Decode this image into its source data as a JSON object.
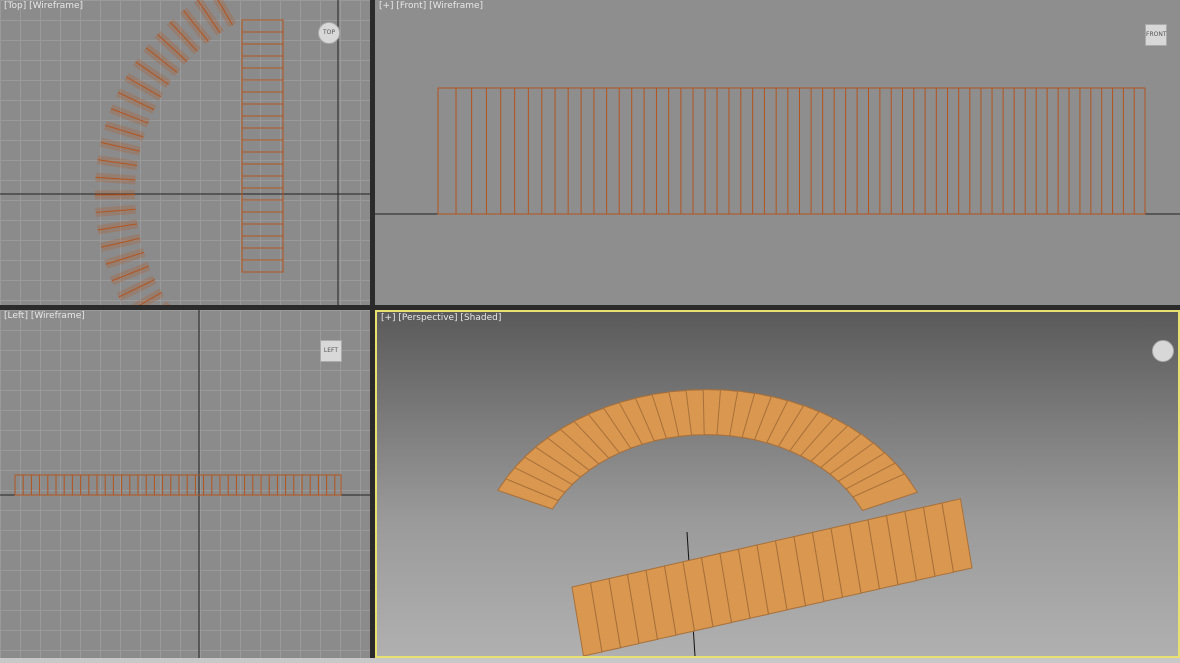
{
  "viewports": {
    "top": {
      "label": "[Top] [Wireframe]",
      "cube": "TOP"
    },
    "front": {
      "label": "[+] [Front] [Wireframe]",
      "cube": "FRONT"
    },
    "left": {
      "label": "[Left] [Wireframe]",
      "cube": "LEFT"
    },
    "perspective": {
      "label": "[+] [Perspective] [Shaded]",
      "active": true
    }
  },
  "colors": {
    "wire": "#b3541e",
    "plank": "#d9974f",
    "active_border": "#e8e070"
  }
}
